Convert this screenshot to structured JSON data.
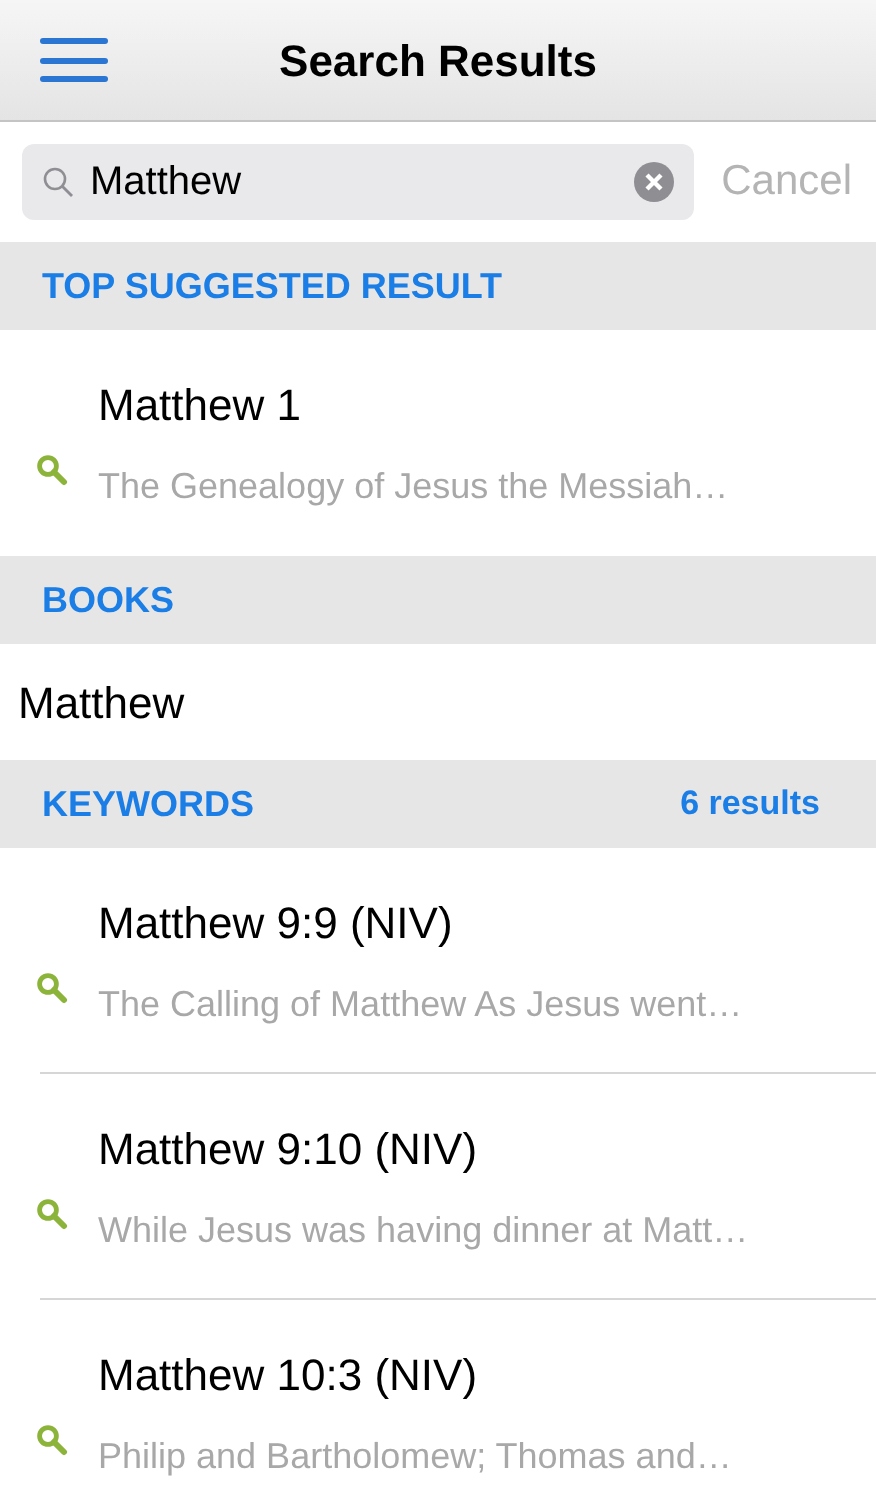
{
  "header": {
    "title": "Search Results"
  },
  "search": {
    "value": "Matthew",
    "cancel": {
      "label": "Cancel",
      "disabled": true
    }
  },
  "sections": [
    {
      "title": "TOP SUGGESTED RESULT",
      "kind": "results",
      "items": [
        {
          "title": "Matthew 1",
          "snippet": "The Genealogy of Jesus the Messiah…"
        }
      ]
    },
    {
      "title": "BOOKS",
      "kind": "books",
      "items": [
        {
          "title": "Matthew"
        }
      ]
    },
    {
      "title": "KEYWORDS",
      "count": "6 results",
      "kind": "results",
      "items": [
        {
          "title": "Matthew 9:9 (NIV)",
          "snippet": "The Calling of Matthew As Jesus went…"
        },
        {
          "title": "Matthew 9:10 (NIV)",
          "snippet": "While Jesus was having dinner at Matt…"
        },
        {
          "title": "Matthew 10:3 (NIV)",
          "snippet": "Philip and Bartholomew; Thomas and…"
        }
      ]
    }
  ]
}
